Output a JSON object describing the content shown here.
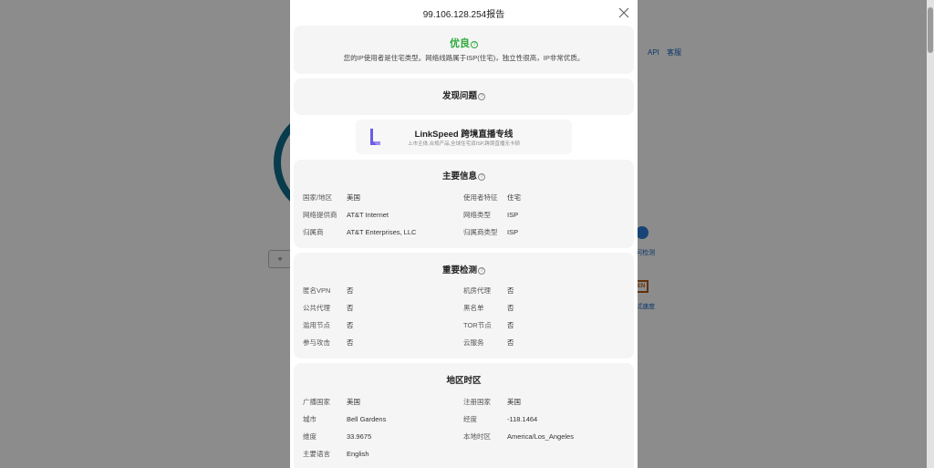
{
  "background": {
    "nav": [
      "API",
      "客服"
    ],
    "ring_color": "#0f6e8a",
    "search_icon": "location-pin-icon",
    "link1": "问检测",
    "en_badge": "EN",
    "link2": "试速度"
  },
  "modal": {
    "title": "99.106.128.254报告",
    "close_icon": "close-icon",
    "verdict": {
      "grade": "优良",
      "grade_color": "#2eaa3c",
      "description": "您的IP使用者是住宅类型。网络线路属于ISP(住宅)，独立性很高，IP非常优质。"
    },
    "issues": {
      "title": "发现问题"
    },
    "ad": {
      "title": "LinkSpeed 跨境直播专线",
      "subtitle": "上市主体,合规产品,全球住宅双ISP,跨境直播无卡顿",
      "accent": "#6b5ce7"
    },
    "main_info": {
      "title": "主要信息",
      "rows": [
        {
          "label": "国家/地区",
          "value": "美国"
        },
        {
          "label": "使用者特征",
          "value": "住宅"
        },
        {
          "label": "网络提供商",
          "value": "AT&T Internet"
        },
        {
          "label": "网络类型",
          "value": "ISP"
        },
        {
          "label": "归属商",
          "value": "AT&T Enterprises, LLC"
        },
        {
          "label": "归属商类型",
          "value": "ISP"
        }
      ]
    },
    "detection": {
      "title": "重要检测",
      "rows": [
        {
          "label": "匿名VPN",
          "value": "否"
        },
        {
          "label": "机房代理",
          "value": "否"
        },
        {
          "label": "公共代理",
          "value": "否"
        },
        {
          "label": "黑名单",
          "value": "否"
        },
        {
          "label": "滥用节点",
          "value": "否"
        },
        {
          "label": "TOR节点",
          "value": "否"
        },
        {
          "label": "参与攻击",
          "value": "否"
        },
        {
          "label": "云服务",
          "value": "否"
        }
      ]
    },
    "geo": {
      "title": "地区时区",
      "rows": [
        {
          "label": "广播国家",
          "value": "美国"
        },
        {
          "label": "注册国家",
          "value": "美国"
        },
        {
          "label": "城市",
          "value": "Bell Gardens"
        },
        {
          "label": "经度",
          "value": "-118.1464"
        },
        {
          "label": "维度",
          "value": "33.9675"
        },
        {
          "label": "本地时区",
          "value": "America/Los_Angeles"
        },
        {
          "label": "主要语言",
          "value": "English"
        }
      ]
    }
  }
}
